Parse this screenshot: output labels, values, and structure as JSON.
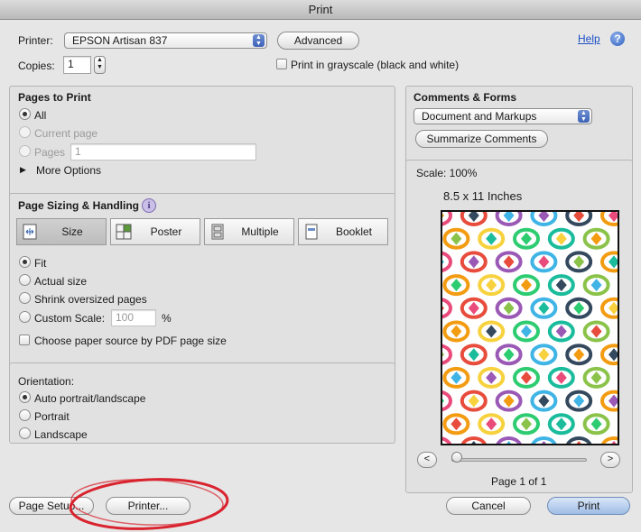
{
  "window": {
    "title": "Print"
  },
  "header": {
    "printer_label": "Printer:",
    "printer_value": "EPSON Artisan 837",
    "advanced_label": "Advanced",
    "help_label": "Help",
    "copies_label": "Copies:",
    "copies_value": "1",
    "grayscale_label": "Print in grayscale (black and white)"
  },
  "pages_to_print": {
    "title": "Pages to Print",
    "all_label": "All",
    "current_label": "Current page",
    "pages_label": "Pages",
    "pages_value": "1",
    "more_label": "More Options"
  },
  "comments_forms": {
    "title": "Comments & Forms",
    "select_value": "Document and Markups",
    "summarize_label": "Summarize Comments"
  },
  "sizing": {
    "title": "Page Sizing & Handling",
    "tabs": [
      "Size",
      "Poster",
      "Multiple",
      "Booklet"
    ],
    "fit_label": "Fit",
    "actual_label": "Actual size",
    "shrink_label": "Shrink oversized pages",
    "custom_label": "Custom Scale:",
    "custom_value": "100",
    "percent": "%",
    "paper_source_label": "Choose paper source by PDF page size"
  },
  "orientation": {
    "title": "Orientation:",
    "auto_label": "Auto portrait/landscape",
    "portrait_label": "Portrait",
    "landscape_label": "Landscape"
  },
  "preview": {
    "scale_text": "Scale: 100%",
    "page_size": "8.5 x 11 Inches",
    "page_indicator": "Page 1 of 1",
    "prev": "<",
    "next": ">",
    "slider_fraction": 0.0,
    "colors": [
      "#e94b7b",
      "#3fb4e5",
      "#f7d23e",
      "#8bc34a",
      "#9b59b6",
      "#f39c12",
      "#1abc9c",
      "#e74c3c",
      "#34495e",
      "#2ecc71"
    ]
  },
  "footer": {
    "page_setup_label": "Page Setup...",
    "printer_label": "Printer...",
    "cancel_label": "Cancel",
    "print_label": "Print"
  },
  "annotation": {
    "color": "#d9232e"
  }
}
